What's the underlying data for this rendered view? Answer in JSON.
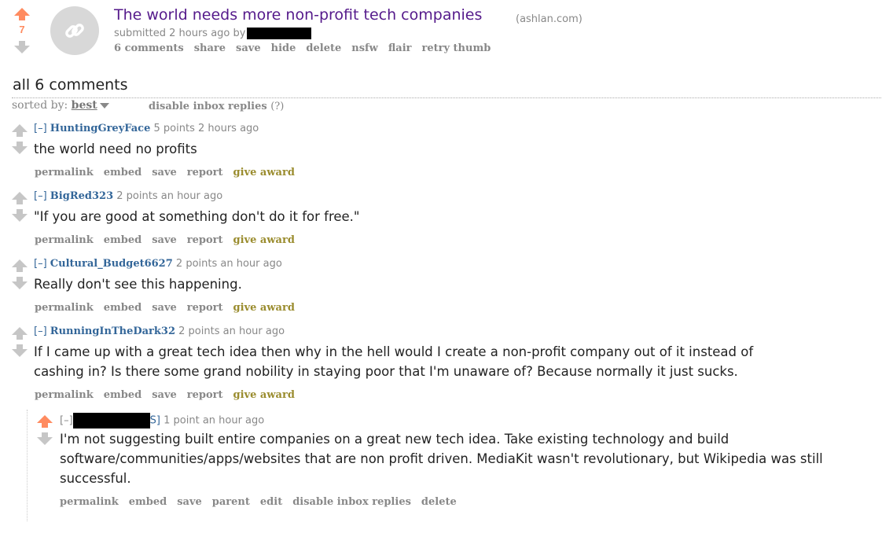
{
  "post": {
    "score": "7",
    "title": "The world needs more non-profit tech companies",
    "domain": "(ashlan.com)",
    "submitted": "submitted 2 hours ago by",
    "buttons": [
      "6 comments",
      "share",
      "save",
      "hide",
      "delete",
      "nsfw",
      "flair",
      "retry thumb"
    ],
    "thumbnail_icon": "link-icon",
    "upvote_color": "#ff8b60"
  },
  "comments_header": {
    "title": "all 6 comments",
    "sorted_label": "sorted by:",
    "sort_value": "best",
    "inbox_link": "disable inbox replies",
    "inbox_help": "(?)"
  },
  "comments": [
    {
      "collapse": "[–]",
      "author": "HuntingGreyFace",
      "meta": "5 points 2 hours ago",
      "body": "the world need no profits",
      "buttons": [
        "permalink",
        "embed",
        "save",
        "report"
      ],
      "award": "give award"
    },
    {
      "collapse": "[–]",
      "author": "BigRed323",
      "meta": "2 points an hour ago",
      "body": "\"If you are good at something don't do it for free.\"",
      "buttons": [
        "permalink",
        "embed",
        "save",
        "report"
      ],
      "award": "give award"
    },
    {
      "collapse": "[–]",
      "author": "Cultural_Budget6627",
      "meta": "2 points an hour ago",
      "body": "Really don't see this happening.",
      "buttons": [
        "permalink",
        "embed",
        "save",
        "report"
      ],
      "award": "give award"
    },
    {
      "collapse": "[–]",
      "author": "RunningInTheDark32",
      "meta": "2 points an hour ago",
      "body_lines": [
        "If I came up with a great tech idea then why in the hell would I create a non-profit company out of it instead of",
        "cashing in? Is there some grand nobility in staying poor that I'm unaware of? Because normally it just sucks."
      ],
      "buttons": [
        "permalink",
        "embed",
        "save",
        "report"
      ],
      "award": "give award"
    }
  ],
  "reply": {
    "collapse": "[–]",
    "submitter_tag": "S]",
    "meta": "1 point an hour ago",
    "body_lines": [
      "I'm not suggesting built entire companies on a great new tech idea. Take existing technology and build",
      "software/communities/apps/websites that are non profit driven. MediaKit wasn't revolutionary, but Wikipedia was still",
      "successful."
    ],
    "buttons": [
      "permalink",
      "embed",
      "save",
      "parent",
      "edit",
      "disable inbox replies",
      "delete"
    ]
  },
  "colors": {
    "title_link": "#551a8b",
    "author_link": "#369",
    "award": "#9a8c2e",
    "muted": "#888"
  }
}
